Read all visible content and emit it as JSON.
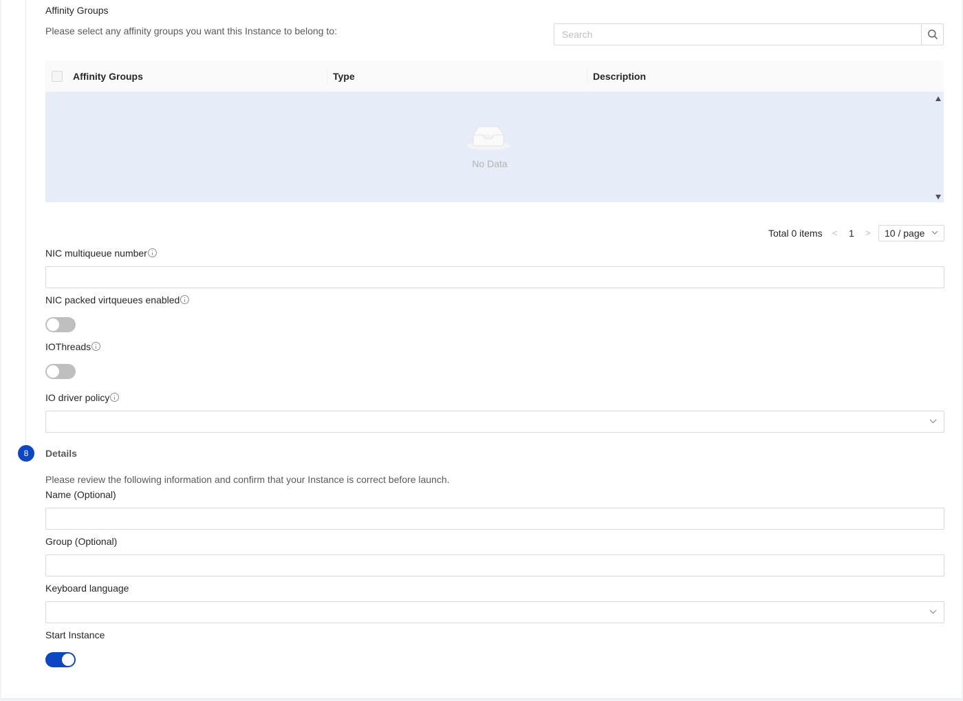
{
  "affinity": {
    "title": "Affinity Groups",
    "description": "Please select any affinity groups you want this Instance to belong to:",
    "search_placeholder": "Search",
    "columns": [
      "Affinity Groups",
      "Type",
      "Description"
    ],
    "empty_text": "No Data"
  },
  "pagination": {
    "total": "Total 0 items",
    "prev": "<",
    "page": "1",
    "next": ">",
    "page_size": "10 / page"
  },
  "fields": {
    "nic_multiqueue_label": "NIC multiqueue number",
    "nic_multiqueue_value": "",
    "nic_packed_label": "NIC packed virtqueues enabled",
    "nic_packed_enabled": false,
    "iothreads_label": "IOThreads",
    "iothreads_enabled": false,
    "io_driver_label": "IO driver policy",
    "io_driver_value": ""
  },
  "details": {
    "step_number": "8",
    "title": "Details",
    "description": "Please review the following information and confirm that your Instance is correct before launch.",
    "name_label": "Name (Optional)",
    "name_value": "",
    "group_label": "Group (Optional)",
    "group_value": "",
    "keyboard_label": "Keyboard language",
    "keyboard_value": "",
    "start_label": "Start Instance",
    "start_enabled": true
  },
  "colors": {
    "accent": "#0c46c2",
    "table_body_bg": "#e6ecf8",
    "toggle_off": "#bfbfbf"
  }
}
